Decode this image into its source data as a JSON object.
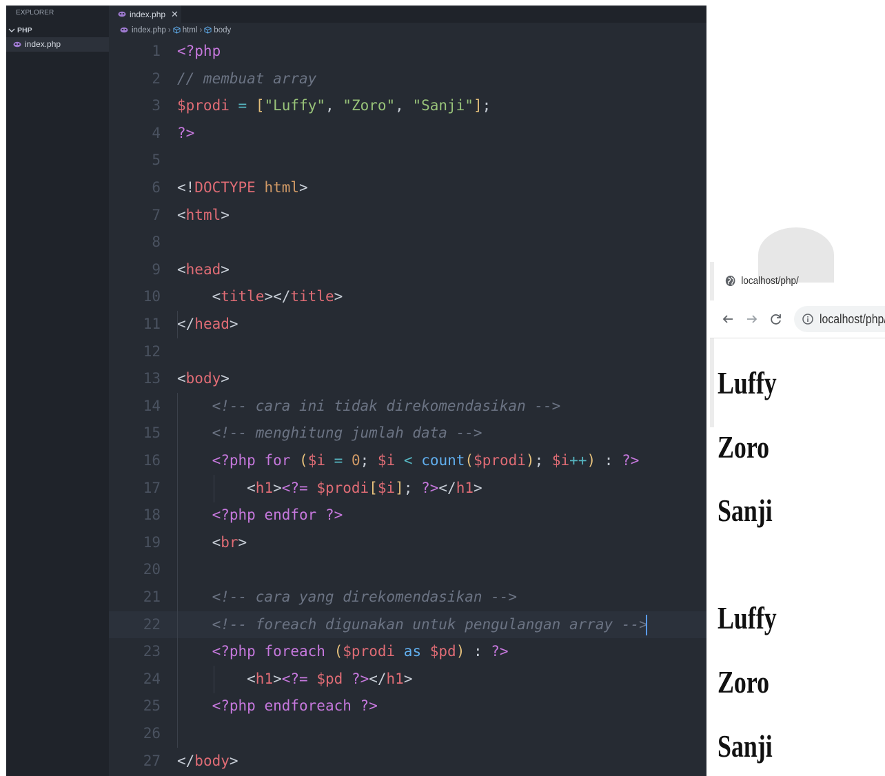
{
  "explorer": {
    "title": "EXPLORER",
    "folder": "PHP",
    "files": [
      "index.php"
    ]
  },
  "editor": {
    "tab": {
      "label": "index.php",
      "close": "✕"
    },
    "breadcrumb": [
      "index.php",
      "html",
      "body"
    ],
    "current_line": 22,
    "lines": [
      {
        "n": "1",
        "tokens": [
          [
            "t-php",
            "<?php"
          ]
        ]
      },
      {
        "n": "2",
        "tokens": [
          [
            "t-com",
            "// membuat array"
          ]
        ]
      },
      {
        "n": "3",
        "tokens": [
          [
            "t-var",
            "$prodi"
          ],
          [
            "t-punc",
            " "
          ],
          [
            "t-op",
            "="
          ],
          [
            "t-punc",
            " "
          ],
          [
            "t-paren",
            "["
          ],
          [
            "t-str",
            "\"Luffy\""
          ],
          [
            "t-punc",
            ", "
          ],
          [
            "t-str",
            "\"Zoro\""
          ],
          [
            "t-punc",
            ", "
          ],
          [
            "t-str",
            "\"Sanji\""
          ],
          [
            "t-paren",
            "]"
          ],
          [
            "t-punc",
            ";"
          ]
        ]
      },
      {
        "n": "4",
        "tokens": [
          [
            "t-php",
            "?>"
          ]
        ]
      },
      {
        "n": "5",
        "tokens": []
      },
      {
        "n": "6",
        "tokens": [
          [
            "t-punc",
            "<!"
          ],
          [
            "t-tag",
            "DOCTYPE"
          ],
          [
            "t-punc",
            " "
          ],
          [
            "t-num",
            "html"
          ],
          [
            "t-punc",
            ">"
          ]
        ]
      },
      {
        "n": "7",
        "tokens": [
          [
            "t-punc",
            "<"
          ],
          [
            "t-tag",
            "html"
          ],
          [
            "t-punc",
            ">"
          ]
        ]
      },
      {
        "n": "8",
        "tokens": []
      },
      {
        "n": "9",
        "tokens": [
          [
            "t-punc",
            "<"
          ],
          [
            "t-tag",
            "head"
          ],
          [
            "t-punc",
            ">"
          ]
        ]
      },
      {
        "n": "10",
        "tokens": [
          [
            "t-punc",
            "    <"
          ],
          [
            "t-tag",
            "title"
          ],
          [
            "t-punc",
            "></"
          ],
          [
            "t-tag",
            "title"
          ],
          [
            "t-punc",
            ">"
          ]
        ]
      },
      {
        "n": "11",
        "tokens": [
          [
            "t-punc",
            "</"
          ],
          [
            "t-tag",
            "head"
          ],
          [
            "t-punc",
            ">"
          ]
        ]
      },
      {
        "n": "12",
        "tokens": []
      },
      {
        "n": "13",
        "tokens": [
          [
            "t-punc",
            "<"
          ],
          [
            "t-tag",
            "body"
          ],
          [
            "t-punc",
            ">"
          ]
        ]
      },
      {
        "n": "14",
        "tokens": [
          [
            "t-com",
            "    <!-- cara ini tidak direkomendasikan -->"
          ]
        ]
      },
      {
        "n": "15",
        "tokens": [
          [
            "t-com",
            "    <!-- menghitung jumlah data -->"
          ]
        ]
      },
      {
        "n": "16",
        "tokens": [
          [
            "t-php",
            "    <?php"
          ],
          [
            "t-punc",
            " "
          ],
          [
            "t-kw",
            "for"
          ],
          [
            "t-punc",
            " "
          ],
          [
            "t-paren",
            "("
          ],
          [
            "t-var",
            "$i"
          ],
          [
            "t-punc",
            " "
          ],
          [
            "t-op",
            "="
          ],
          [
            "t-punc",
            " "
          ],
          [
            "t-num",
            "0"
          ],
          [
            "t-punc",
            "; "
          ],
          [
            "t-var",
            "$i"
          ],
          [
            "t-punc",
            " "
          ],
          [
            "t-op",
            "<"
          ],
          [
            "t-punc",
            " "
          ],
          [
            "t-fn",
            "count"
          ],
          [
            "t-paren",
            "("
          ],
          [
            "t-var",
            "$prodi"
          ],
          [
            "t-paren",
            ")"
          ],
          [
            "t-punc",
            "; "
          ],
          [
            "t-var",
            "$i"
          ],
          [
            "t-op",
            "++"
          ],
          [
            "t-paren",
            ")"
          ],
          [
            "t-punc",
            " : "
          ],
          [
            "t-php",
            "?>"
          ]
        ]
      },
      {
        "n": "17",
        "tokens": [
          [
            "t-punc",
            "        <"
          ],
          [
            "t-tag",
            "h1"
          ],
          [
            "t-punc",
            ">"
          ],
          [
            "t-php",
            "<?="
          ],
          [
            "t-punc",
            " "
          ],
          [
            "t-var",
            "$prodi"
          ],
          [
            "t-paren",
            "["
          ],
          [
            "t-var",
            "$i"
          ],
          [
            "t-paren",
            "]"
          ],
          [
            "t-punc",
            "; "
          ],
          [
            "t-php",
            "?>"
          ],
          [
            "t-punc",
            "</"
          ],
          [
            "t-tag",
            "h1"
          ],
          [
            "t-punc",
            ">"
          ]
        ]
      },
      {
        "n": "18",
        "tokens": [
          [
            "t-php",
            "    <?php"
          ],
          [
            "t-punc",
            " "
          ],
          [
            "t-kw",
            "endfor"
          ],
          [
            "t-punc",
            " "
          ],
          [
            "t-php",
            "?>"
          ]
        ]
      },
      {
        "n": "19",
        "tokens": [
          [
            "t-punc",
            "    <"
          ],
          [
            "t-tag",
            "br"
          ],
          [
            "t-punc",
            ">"
          ]
        ]
      },
      {
        "n": "20",
        "tokens": []
      },
      {
        "n": "21",
        "tokens": [
          [
            "t-com",
            "    <!-- cara yang direkomendasikan -->"
          ]
        ]
      },
      {
        "n": "22",
        "tokens": [
          [
            "t-com",
            "    <!-- foreach digunakan untuk pengulangan array -->"
          ]
        ]
      },
      {
        "n": "23",
        "tokens": [
          [
            "t-php",
            "    <?php"
          ],
          [
            "t-punc",
            " "
          ],
          [
            "t-kw",
            "foreach"
          ],
          [
            "t-punc",
            " "
          ],
          [
            "t-paren",
            "("
          ],
          [
            "t-var",
            "$prodi"
          ],
          [
            "t-punc",
            " "
          ],
          [
            "t-fn",
            "as"
          ],
          [
            "t-punc",
            " "
          ],
          [
            "t-var",
            "$pd"
          ],
          [
            "t-paren",
            ")"
          ],
          [
            "t-punc",
            " : "
          ],
          [
            "t-php",
            "?>"
          ]
        ]
      },
      {
        "n": "24",
        "tokens": [
          [
            "t-punc",
            "        <"
          ],
          [
            "t-tag",
            "h1"
          ],
          [
            "t-punc",
            ">"
          ],
          [
            "t-php",
            "<?="
          ],
          [
            "t-punc",
            " "
          ],
          [
            "t-var",
            "$pd"
          ],
          [
            "t-punc",
            " "
          ],
          [
            "t-php",
            "?>"
          ],
          [
            "t-punc",
            "</"
          ],
          [
            "t-tag",
            "h1"
          ],
          [
            "t-punc",
            ">"
          ]
        ]
      },
      {
        "n": "25",
        "tokens": [
          [
            "t-php",
            "    <?php"
          ],
          [
            "t-punc",
            " "
          ],
          [
            "t-kw",
            "endforeach"
          ],
          [
            "t-punc",
            " "
          ],
          [
            "t-php",
            "?>"
          ]
        ]
      },
      {
        "n": "26",
        "tokens": []
      },
      {
        "n": "27",
        "tokens": [
          [
            "t-punc",
            "</"
          ],
          [
            "t-tag",
            "body"
          ],
          [
            "t-punc",
            ">"
          ]
        ]
      }
    ]
  },
  "browser": {
    "tab_title": "localhost/php/",
    "url": "localhost/php/",
    "headings": [
      "Luffy",
      "Zoro",
      "Sanji",
      "Luffy",
      "Zoro",
      "Sanji"
    ]
  }
}
